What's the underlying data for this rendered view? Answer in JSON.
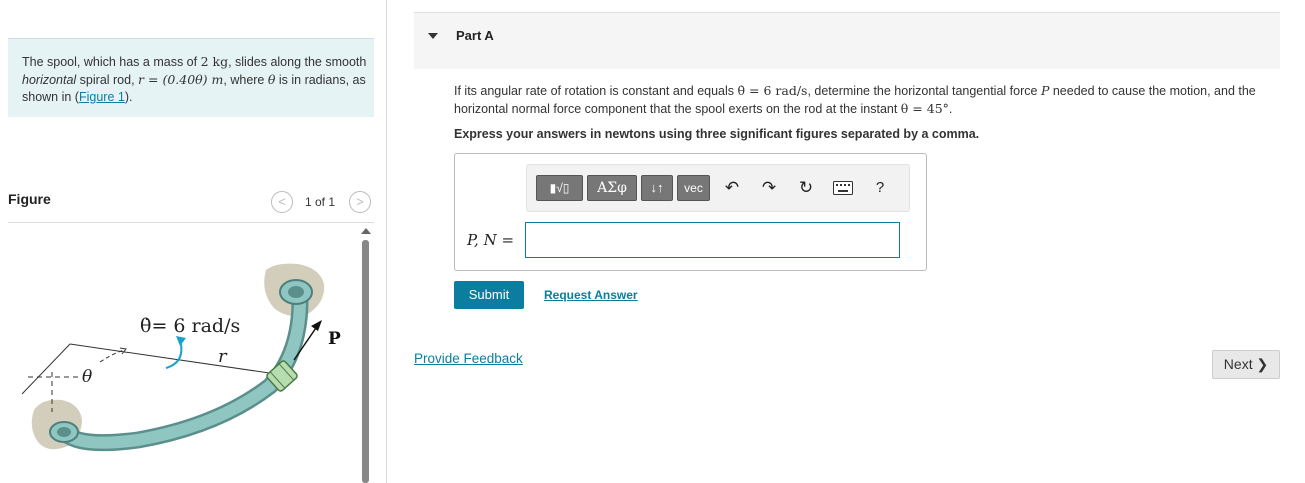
{
  "problem": {
    "t1": "The spool, which has a mass of ",
    "mass": "2 kg",
    "t2": ", slides along the smooth ",
    "italic_word": "horizontal",
    "t3": " spiral rod, ",
    "equation": "r = (0.40θ) m",
    "t4": ", where ",
    "theta": "θ",
    "t5": " is in radians, as shown in (",
    "figure_link": "Figure 1",
    "t6": ")."
  },
  "figure_panel": {
    "title": "Figure",
    "pager": "1 of 1",
    "prev_icon": "<",
    "next_icon": ">",
    "image_labels": {
      "rate": "θ̇= 6 rad/s",
      "r": "r",
      "theta": "θ",
      "P": "P"
    }
  },
  "part": {
    "title": "Part A",
    "q1": "If its angular rate of rotation is constant and equals ",
    "rate": "θ̇ = 6 rad/s",
    "q2": ", determine the horizontal tangential force ",
    "force": "P",
    "q3": " needed to cause the motion, and the horizontal normal force component that the spool exerts on the rod at the instant ",
    "angle": "θ = 45°",
    "q4": ".",
    "instructions": "Express your answers in newtons using three significant figures separated by a comma."
  },
  "toolbar": {
    "greek": "ΑΣφ",
    "arrows": "↓↑",
    "vec": "vec",
    "help": "?"
  },
  "answer": {
    "label": "P, N =",
    "value": ""
  },
  "buttons": {
    "submit": "Submit",
    "request_answer": "Request Answer",
    "provide_feedback": "Provide Feedback",
    "next": "Next ❯"
  },
  "colors": {
    "accent": "#0b7ea0",
    "problem_bg": "#e6f3f5",
    "rod": "#7fb9b4"
  }
}
